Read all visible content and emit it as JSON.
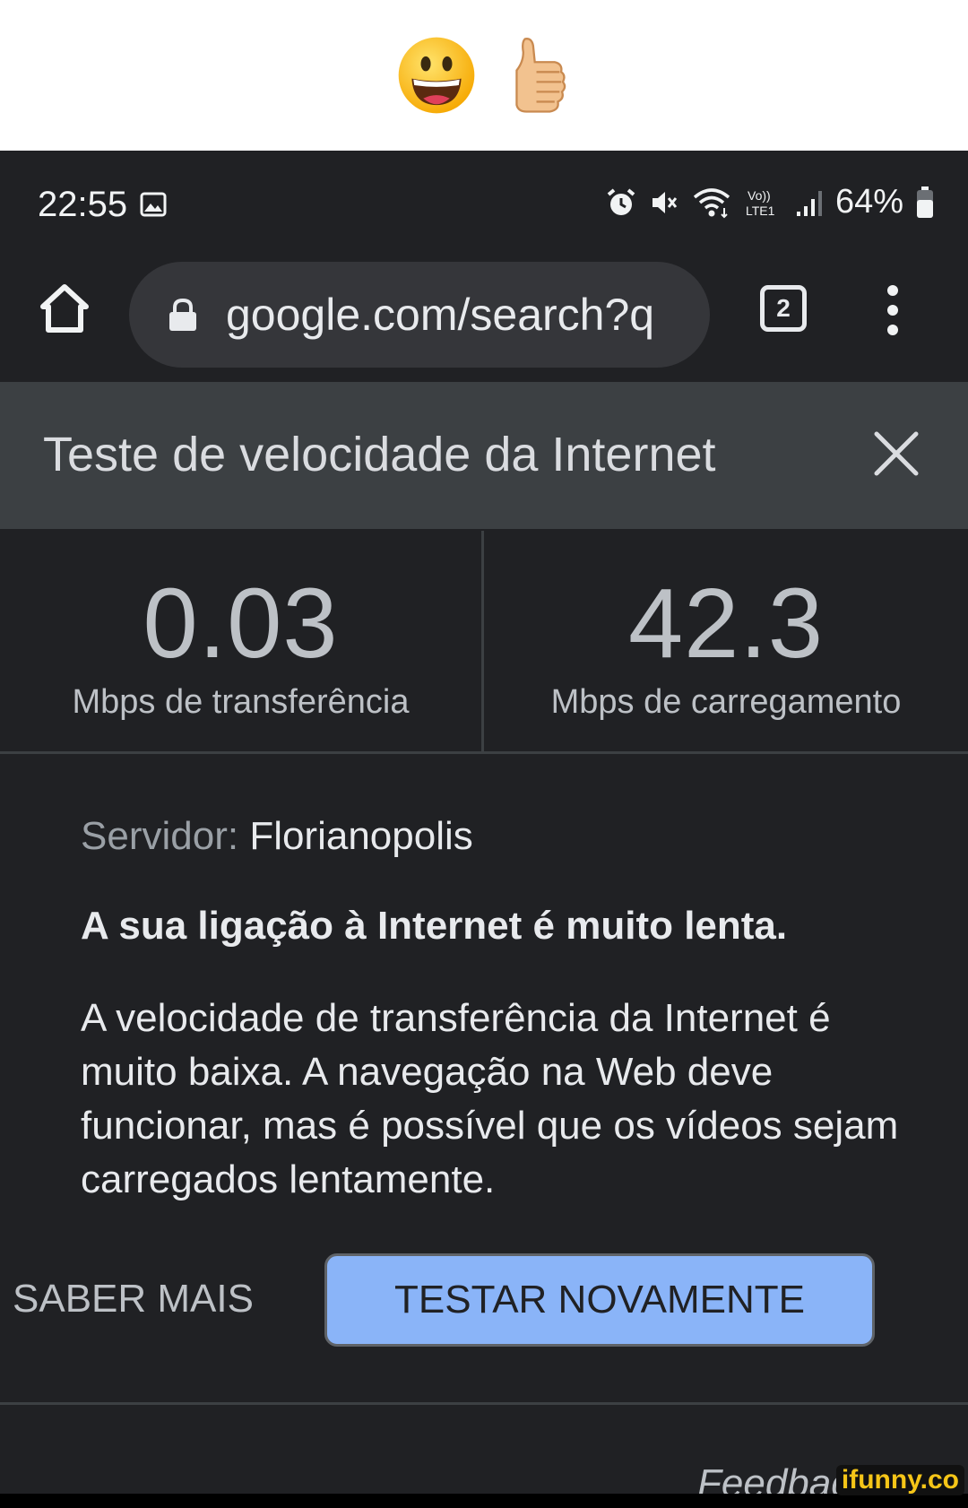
{
  "caption": {
    "emojis": [
      "grinning-face",
      "thumbs-up"
    ]
  },
  "status_bar": {
    "time": "22:55",
    "network": "LTE1",
    "volte": "Vo))",
    "battery": "64%"
  },
  "browser": {
    "url": "google.com/search?q",
    "tab_count": "2"
  },
  "speed_test": {
    "title": "Teste de velocidade da Internet",
    "download_value": "0.03",
    "download_label": "Mbps de transferência",
    "upload_value": "42.3",
    "upload_label": "Mbps de carregamento",
    "server_label": "Servidor:",
    "server_name": "Florianopolis",
    "headline": "A sua ligação à Internet é muito lenta.",
    "description": "A velocidade de transferência da Internet é muito baixa. A navegação na Web deve funcionar, mas é possível que os vídeos sejam carregados lentamente.",
    "learn_more_label": "SABER MAIS",
    "retest_label": "TESTAR NOVAMENTE",
    "feedback_label": "Feedback"
  },
  "watermark": "ifunny.co",
  "colors": {
    "background": "#202124",
    "header": "#3c4043",
    "accent_button": "#8ab4f8"
  }
}
